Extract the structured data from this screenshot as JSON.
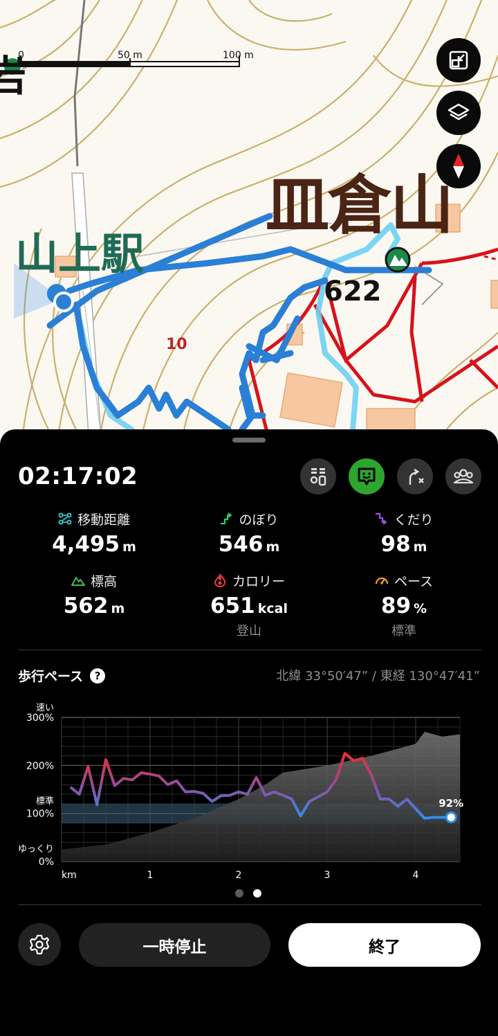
{
  "map": {
    "labels": {
      "mountain": "皿倉山",
      "station": "山上駅",
      "rock": "岩",
      "elevation_mark": "622",
      "contour": "10"
    },
    "scale": {
      "zero": "0",
      "mid": "50 m",
      "max": "100 m"
    },
    "buttons": [
      "shrink-icon",
      "layers-icon",
      "compass-icon"
    ]
  },
  "panel": {
    "elapsed": "02:17:02",
    "top_icons": [
      "route-points-icon",
      "chat-icon",
      "route-shortcut-icon",
      "group-icon"
    ],
    "stats": [
      {
        "label": "移動距離",
        "value": "4,495",
        "unit": "m",
        "icon": "distance-icon",
        "sub": ""
      },
      {
        "label": "のぼり",
        "value": "546",
        "unit": "m",
        "icon": "ascent-icon",
        "sub": ""
      },
      {
        "label": "くだり",
        "value": "98",
        "unit": "m",
        "icon": "descent-icon",
        "sub": ""
      },
      {
        "label": "標高",
        "value": "562",
        "unit": "m",
        "icon": "mountain-icon",
        "sub": ""
      },
      {
        "label": "カロリー",
        "value": "651",
        "unit": "kcal",
        "icon": "calorie-icon",
        "sub": "登山"
      },
      {
        "label": "ペース",
        "value": "89",
        "unit": "%",
        "icon": "pace-icon",
        "sub": "標準"
      }
    ],
    "pace": {
      "title": "歩行ペース",
      "help": "?",
      "coords": "北緯 33°50′47” / 東経 130°47′41”"
    },
    "pause_label": "一時停止",
    "end_label": "終了"
  },
  "chart_data": {
    "type": "line",
    "title": "歩行ペース",
    "xlabel": "km",
    "x_ticks": [
      "1",
      "2",
      "3",
      "4"
    ],
    "y_ticks": [
      "0%",
      "100%",
      "200%",
      "300%"
    ],
    "y_top_label": "速い",
    "y_mid_label": "標準",
    "y_bottom_label": "ゆっくり",
    "xlim": [
      0,
      4.5
    ],
    "ylim": [
      0,
      300
    ],
    "end_label": "92%",
    "series": [
      {
        "values_x": [
          0.1,
          0.2,
          0.3,
          0.4,
          0.5,
          0.6,
          0.7,
          0.8,
          0.9,
          1.0,
          1.1,
          1.2,
          1.3,
          1.4,
          1.5,
          1.6,
          1.7,
          1.8,
          1.9,
          2.0,
          2.1,
          2.2,
          2.3,
          2.4,
          2.5,
          2.6,
          2.7,
          2.8,
          2.9,
          3.0,
          3.1,
          3.2,
          3.3,
          3.4,
          3.5,
          3.6,
          3.7,
          3.8,
          3.9,
          4.0,
          4.1,
          4.2,
          4.3,
          4.4
        ],
        "values_y": [
          155,
          140,
          198,
          118,
          212,
          158,
          173,
          170,
          185,
          182,
          178,
          160,
          168,
          145,
          146,
          142,
          125,
          137,
          138,
          145,
          140,
          175,
          138,
          145,
          138,
          130,
          95,
          125,
          135,
          145,
          170,
          225,
          210,
          215,
          180,
          130,
          130,
          115,
          130,
          110,
          90,
          92,
          92,
          92
        ]
      }
    ],
    "elevation_profile": {
      "values_x": [
        0,
        0.5,
        1.0,
        1.5,
        2.0,
        2.3,
        2.5,
        3.0,
        3.5,
        4.0,
        4.1,
        4.3,
        4.5
      ],
      "values_y": [
        25,
        35,
        60,
        90,
        130,
        160,
        185,
        200,
        220,
        245,
        270,
        260,
        265
      ]
    }
  }
}
